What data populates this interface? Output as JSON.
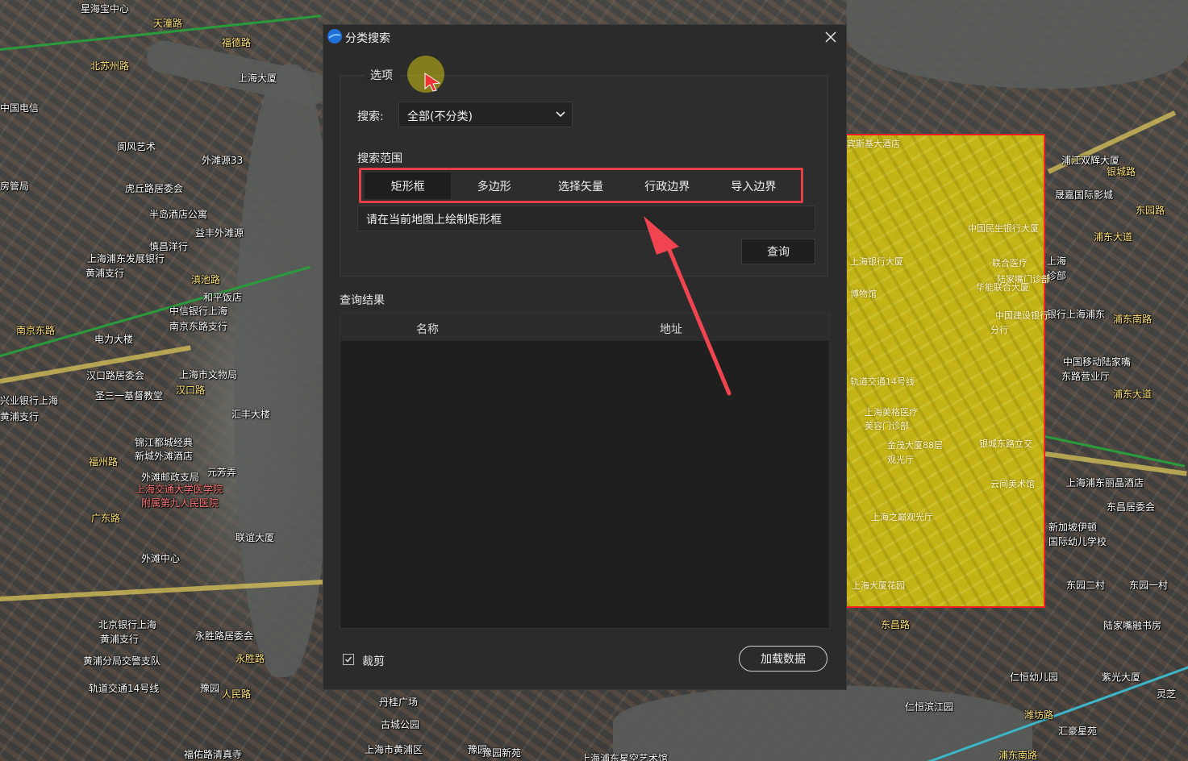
{
  "dialog": {
    "title": "分类搜索",
    "close_icon": "close-icon",
    "options_group_label": "选项",
    "search_label": "搜索:",
    "search_select_value": "全部(不分类)",
    "range_label": "搜索范围",
    "range_tabs": [
      {
        "label": "矩形框",
        "active": true
      },
      {
        "label": "多边形",
        "active": false
      },
      {
        "label": "选择矢量",
        "active": false
      },
      {
        "label": "行政边界",
        "active": false
      },
      {
        "label": "导入边界",
        "active": false
      }
    ],
    "hint_text": "请在当前地图上绘制矩形框",
    "query_button": "查询",
    "results_label": "查询结果",
    "results_columns": [
      "名称",
      "地址"
    ],
    "results_rows": [],
    "clip_label": "裁剪",
    "clip_checked": true,
    "load_button": "加载数据"
  },
  "colors": {
    "highlight_red": "#e5404a",
    "selection_yellow": "#e6d20a",
    "selection_border": "#ff2020",
    "dialog_bg": "#2b2b2b"
  },
  "map_labels": {
    "left": [
      "星海宝中心",
      "天潼路",
      "福德路",
      "北苏州路",
      "上海大厦",
      "中国电信",
      "阆风艺术",
      "外滩源33",
      "房管局",
      "虎丘路居委会",
      "半岛酒店公寓",
      "益丰外滩源",
      "慎昌洋行",
      "上海浦东发展银行",
      "黄浦支行",
      "滇池路",
      "和平饭店",
      "中信银行上海",
      "南京东路支行",
      "南京东路",
      "电力大楼",
      "汉口路居委会",
      "上海市文物局",
      "汉口路",
      "圣三一基督教堂",
      "汇丰大楼",
      "锦江都城经典",
      "新城外滩酒店",
      "福州路",
      "外滩邮政支局",
      "元芳弄",
      "上海交通大学医学院",
      "附属第九人民医院",
      "广东路",
      "联谊大厦",
      "外滩中心",
      "北京银行上海",
      "黄浦支行",
      "永胜路居委会",
      "黄浦分局交警支队",
      "永胜路",
      "轨道交通14号线",
      "豫园",
      "人民路",
      "福佑路清真寺",
      "兴业银行上海",
      "黄浦支行"
    ],
    "bottom": [
      "丹桂广场",
      "古城公园",
      "上海市黄浦区",
      "豫园",
      "豫园新苑",
      "上海浦东星空艺术馆"
    ],
    "selection": [
      "宾斯基大酒店",
      "中国民生银行大厦",
      "联合医疗",
      "陆家嘴门诊部",
      "华能联合大厦",
      "上海银行大厦",
      "博物馆",
      "中国建设银行",
      "分行",
      "轨道交通14号线",
      "上海美格医疗",
      "美容门诊部",
      "金茂大厦88层",
      "观光厅",
      "银城东路立交",
      "云间美术馆",
      "上海之巅观光厅",
      "上海大厦花园"
    ],
    "right": [
      "浦江双辉大厦",
      "银城路",
      "晟嘉国际影城",
      "东园路",
      "浦东大道",
      "上海",
      "诊部",
      "银行上海浦东",
      "浦东南路",
      "中国移动陆家嘴",
      "东路营业厅",
      "浦东大道",
      "上海浦东丽晶酒店",
      "东昌居委会",
      "新加坡伊顿",
      "国际幼儿学校",
      "东园二村",
      "东园一村",
      "陆家嘴融书房",
      "东昌路",
      "仁恒幼儿园",
      "紫光大厦",
      "潍坊路",
      "汇豪星苑",
      "仁恒滨江园",
      "灵芝",
      "浦东南路"
    ]
  }
}
